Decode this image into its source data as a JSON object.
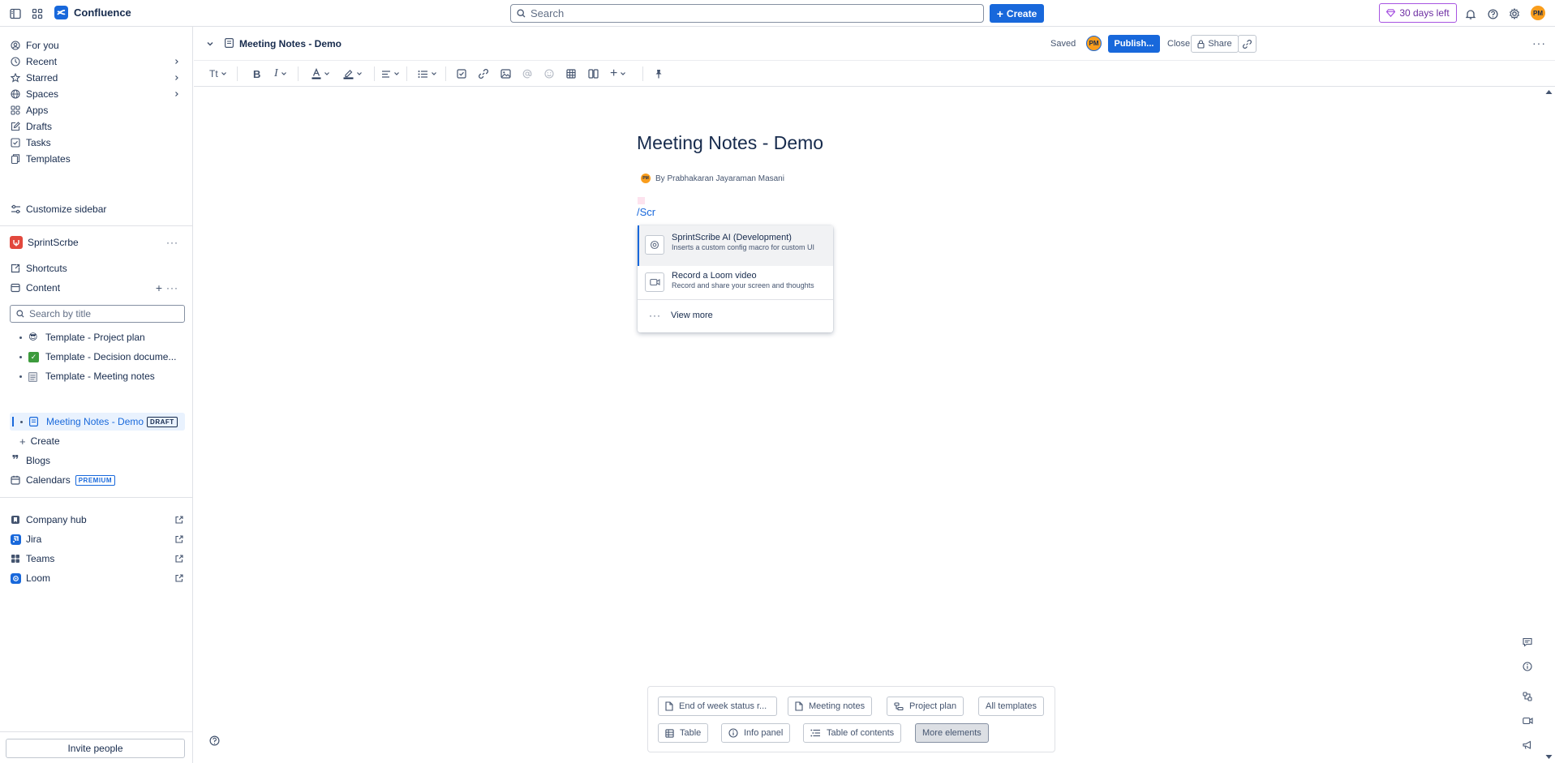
{
  "topnav": {
    "product": "Confluence",
    "search_placeholder": "Search",
    "create_label": "Create",
    "trial_label": "30 days left",
    "avatar_initials": "PM"
  },
  "sidebar": {
    "primary": [
      {
        "label": "For you",
        "icon": "user-circle-icon"
      },
      {
        "label": "Recent",
        "icon": "clock-icon"
      },
      {
        "label": "Starred",
        "icon": "star-icon"
      },
      {
        "label": "Spaces",
        "icon": "globe-icon"
      },
      {
        "label": "Apps",
        "icon": "apps-icon"
      },
      {
        "label": "Drafts",
        "icon": "edit-icon"
      },
      {
        "label": "Tasks",
        "icon": "checkbox-icon"
      },
      {
        "label": "Templates",
        "icon": "template-icon"
      }
    ],
    "customize_label": "Customize sidebar",
    "space_name": "SprintScrbe",
    "shortcuts_label": "Shortcuts",
    "content_label": "Content",
    "search_placeholder": "Search by title",
    "tree": [
      {
        "emoji": "😎",
        "label": "Template - Project plan"
      },
      {
        "emoji": "✅",
        "label": "Template - Decision docume..."
      },
      {
        "emoji": "🗒",
        "label": "Template - Meeting notes"
      },
      {
        "emoji": "page",
        "label": "Meeting Notes - Demo",
        "badge": "DRAFT"
      }
    ],
    "create_label": "Create",
    "blogs_label": "Blogs",
    "calendars_label": "Calendars",
    "premium_badge": "PREMIUM",
    "external": [
      {
        "label": "Company hub"
      },
      {
        "label": "Jira"
      },
      {
        "label": "Teams"
      },
      {
        "label": "Loom"
      }
    ],
    "invite_label": "Invite people"
  },
  "page_header": {
    "title": "Meeting Notes - Demo",
    "saved_label": "Saved",
    "avatar_initials": "PM",
    "publish_label": "Publish...",
    "close_label": "Close",
    "share_label": "Share"
  },
  "toolbar": {
    "text_style_label": "Tt"
  },
  "editor": {
    "title": "Meeting Notes - Demo",
    "byline": "By Prabhakaran Jayaraman Masani",
    "byline_avatar": "PM",
    "typed_text": "/Scr"
  },
  "slash_menu": {
    "items": [
      {
        "title": "SprintScribe AI (Development)",
        "desc": "Inserts a custom config macro for custom UI"
      },
      {
        "title": "Record a Loom video",
        "desc": "Record and share your screen and thoughts"
      }
    ],
    "view_more": "View more"
  },
  "template_bar": {
    "row1": [
      "End of week status r...",
      "Meeting notes",
      "Project plan",
      "All templates"
    ],
    "row2": [
      "Table",
      "Info panel",
      "Table of contents",
      "More elements"
    ]
  },
  "colors": {
    "brand": "#1868db",
    "trial": "#a754e1",
    "avatar": "#f99d1c"
  }
}
